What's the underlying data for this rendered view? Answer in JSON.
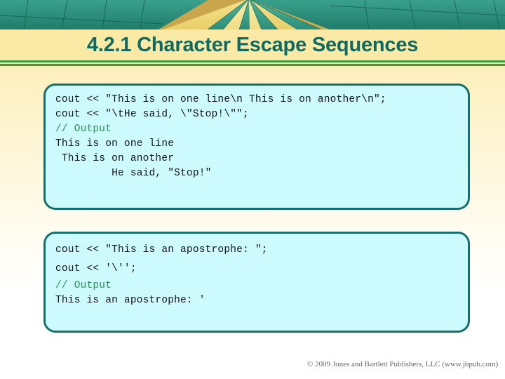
{
  "slide": {
    "title": "4.2.1 Character Escape Sequences",
    "banner_icon": "hot-air-balloon-canopy-photo",
    "colors": {
      "title_text": "#0d6b63",
      "title_band": "#fbe9a6",
      "rule": "#3c9e3c",
      "code_fill": "#cdfbfd",
      "code_border": "#14706e",
      "code_text": "#13131f",
      "comment_text": "#2c8f56",
      "background_top": "#fdecb0",
      "background_bottom": "#ffffff"
    }
  },
  "code_block_1": {
    "lines": [
      "cout << \"This is on one line\\n This is on another\\n\";",
      "cout << \"\\tHe said, \\\"Stop!\\\"\";",
      "",
      "// Output",
      "This is on one line",
      " This is on another",
      "         He said, \"Stop!\""
    ]
  },
  "code_block_2": {
    "lines": [
      "cout << \"This is an apostrophe: \";",
      "cout << '\\'';",
      "",
      "// Output",
      "This is an apostrophe: '"
    ]
  },
  "footer": {
    "copyright": "© 2009 Jones and Bartlett Publishers, LLC (www.jbpub.com)"
  }
}
